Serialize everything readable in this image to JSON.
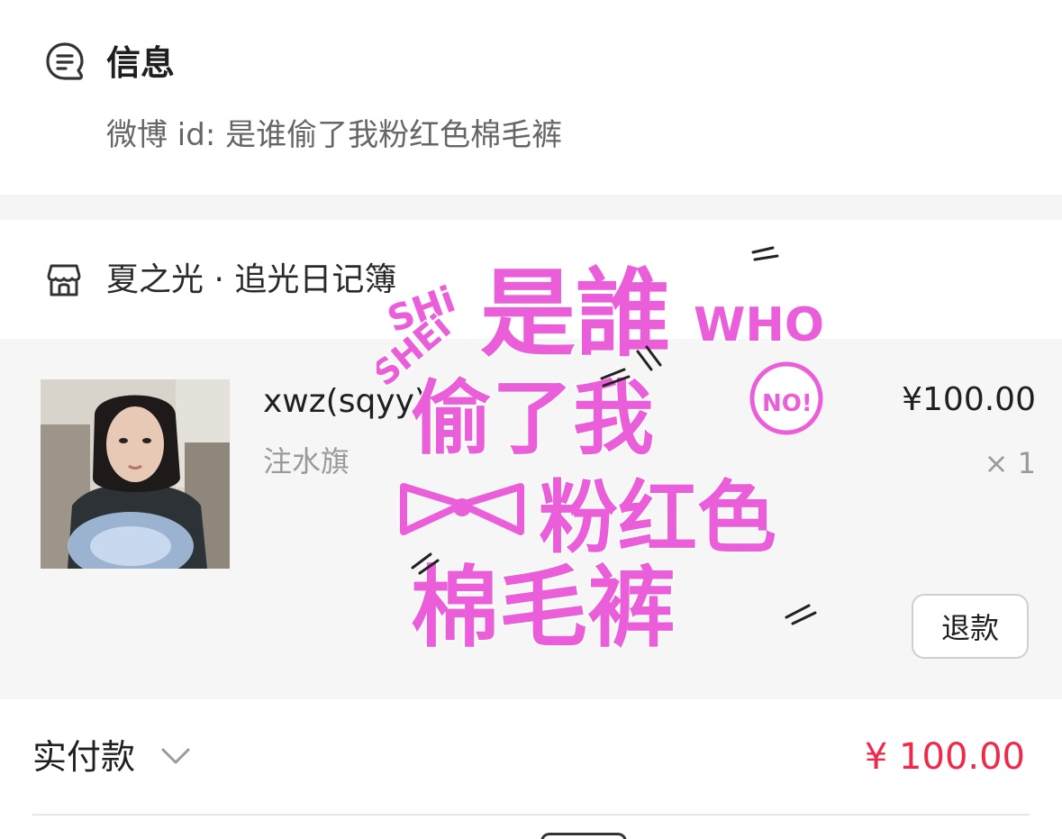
{
  "info": {
    "title": "信息",
    "weibo_line": "微博 id: 是谁偷了我粉红色棉毛裤",
    "icon": "message-icon"
  },
  "shop": {
    "icon": "store-icon",
    "name": "夏之光 · 追光日记簿"
  },
  "item": {
    "title": "xwz(sqyy)",
    "spec": "注水旗",
    "price": "¥100.00",
    "quantity": "× 1",
    "refund_label": "退款"
  },
  "payment": {
    "label": "实付款",
    "amount": "¥ 100.00"
  },
  "sticker": {
    "line1": "是誰",
    "line1_en": "WHO",
    "line2": "偷了我",
    "line3": "粉红色",
    "line4": "棉毛裤",
    "top_pinyin": "SHi",
    "side_pinyin": "SHEi",
    "badge": "NO!"
  },
  "colors": {
    "accent_red": "#f0284a",
    "sticker_pink": "#ea5fd9"
  }
}
